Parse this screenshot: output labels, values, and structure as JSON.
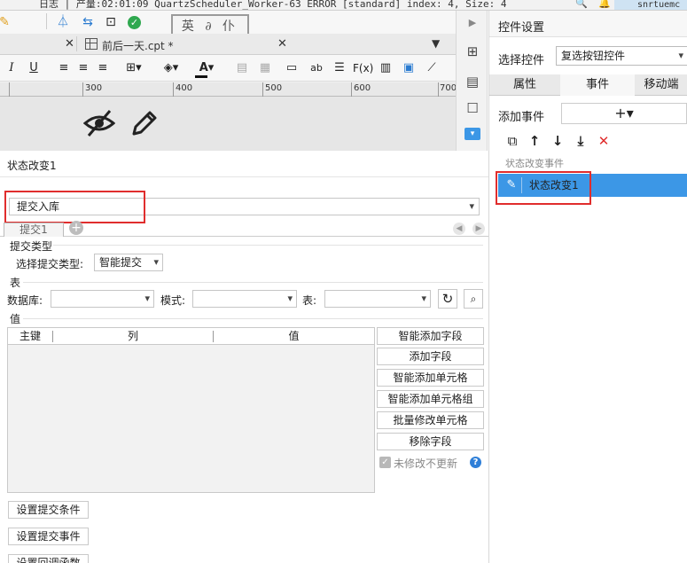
{
  "top_bar": {
    "log_text": "日志 | 产量:02:01:09 QuartzScheduler_Worker-63 ERROR [standard] index: 4, Size: 4",
    "username": "snrtuemc"
  },
  "editor": {
    "stamp_text": "英 ∂ 仆",
    "tab_file_name": "前后一天.cpt *",
    "ruler_numbers": [
      "300",
      "400",
      "500",
      "600",
      "700"
    ]
  },
  "right_panel": {
    "title": "控件设置",
    "select_widget_label": "选择控件",
    "select_widget_value": "复选按钮控件",
    "tabs": [
      "属性",
      "事件",
      "移动端"
    ],
    "active_tab": "事件",
    "add_event_label": "添加事件",
    "add_event_button": "+▾",
    "section_label": "状态改变事件",
    "event_item": "状态改变1"
  },
  "form": {
    "breadcrumb": "状态改变1",
    "action_combo": "提交入库",
    "subtab": "提交1",
    "submit_type_heading": "提交类型",
    "submit_type_label": "选择提交类型:",
    "submit_type_value": "智能提交",
    "table_heading": "表",
    "db_label": "数据库:",
    "mode_label": "模式:",
    "table_label": "表:",
    "value_heading": "值",
    "grid_headers": [
      "主键",
      "列",
      "值"
    ],
    "action_buttons": [
      "智能添加字段",
      "添加字段",
      "智能添加单元格",
      "智能添加单元格组",
      "批量修改单元格",
      "移除字段"
    ],
    "unchanged_label": "未修改不更新",
    "bottom_buttons": [
      "设置提交条件",
      "设置提交事件",
      "设置回调函数"
    ]
  },
  "colors": {
    "accent_blue": "#3c97e6",
    "highlight_red": "#e02d2d"
  }
}
